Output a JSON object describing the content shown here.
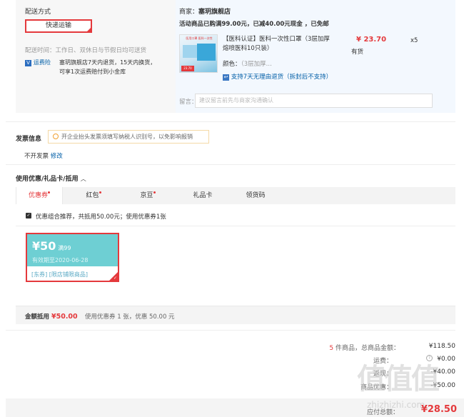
{
  "shipping": {
    "label": "配送方式",
    "method_button": "快递运输",
    "time_label": "配送时间：工作日、双休日与节假日均可送货",
    "service_badge_icon": "V",
    "service_name": "运费险",
    "service_desc_line1": "塞玥旗舰店7天内退货，15天内换货，",
    "service_desc_line2": "可享1次运费赔付到小金库"
  },
  "merchant": {
    "name_label": "商家：",
    "name": "塞玥旗舰店",
    "promo": "活动商品已购满99.00元，已减40.00元现金 ，已免邮",
    "product_title_line1": "【医科认证】医科一次性口罩（3层加厚",
    "product_title_line2": "熔喷医科10只装）",
    "price": "¥ 23.70",
    "stock": "有货",
    "qty": "x5",
    "color_label": "颜色：",
    "color_value": "（3层加厚...",
    "return_policy": "支持7天无理由退货（拆封后不支持）",
    "thumb_title": "医用口罩 医科一次性",
    "thumb_tag": "23.70",
    "message_label": "留言：",
    "message_placeholder": "建议留言前先与商家沟通确认"
  },
  "invoice": {
    "label": "发票信息",
    "tip": "开企业抬头发票须填写纳税人识别号，以免影响报销",
    "status": "不开发票",
    "edit_link": "修改"
  },
  "discounts": {
    "title": "使用优惠/礼品卡/抵用",
    "toggle_icon": "chevron-up-icon",
    "tabs": [
      {
        "label": "优惠券",
        "dot": true,
        "active": true
      },
      {
        "label": "红包",
        "dot": true,
        "active": false
      },
      {
        "label": "京豆",
        "dot": true,
        "active": false
      },
      {
        "label": "礼品卡",
        "dot": false,
        "active": false
      },
      {
        "label": "领货码",
        "dot": false,
        "active": false
      }
    ],
    "recommend_text": "优惠组合推荐，共抵用50.00元；使用优惠券1张",
    "coupon": {
      "amount": "¥50",
      "condition": "满99",
      "valid": "有效期至2020-06-28",
      "tags": "[东券] [限店铺限商品]"
    },
    "summary_label": "金额抵用",
    "summary_amount": "¥50.00",
    "summary_desc": "使用优惠券 1 张，优惠 50.00 元"
  },
  "totals": {
    "count_prefix": "5",
    "count_text": " 件商品，总商品金额：",
    "goods_amount": "¥118.50",
    "shipping_label": "运费：",
    "shipping_amount": "¥0.00",
    "rows": [
      {
        "label": "返现：",
        "value": "-¥40.00"
      },
      {
        "label": "商品优惠：",
        "value": "-¥50.00"
      }
    ],
    "payable_label": "应付总额：",
    "payable_amount": "¥28.50"
  },
  "watermark": {
    "logo_text": "值值值",
    "url": "zhizhizhi.com"
  },
  "colors": {
    "accent_red": "#e4393c",
    "link_blue": "#005ea7",
    "coupon_teal": "#6ecfd3"
  }
}
